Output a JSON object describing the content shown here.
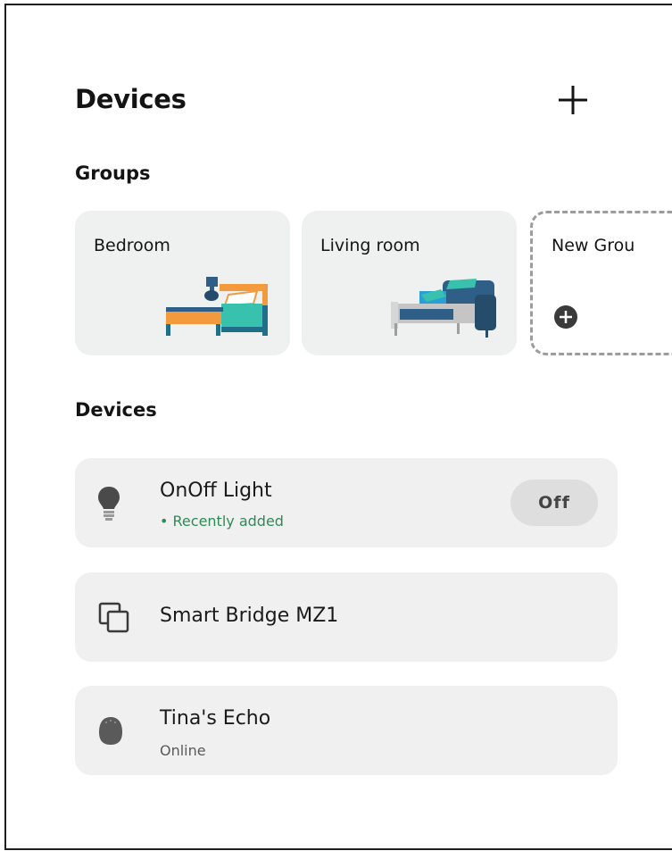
{
  "header": {
    "title": "Devices",
    "add_icon": "plus-icon"
  },
  "groups": {
    "title": "Groups",
    "items": [
      {
        "label": "Bedroom",
        "illustration": "bedroom-illustration"
      },
      {
        "label": "Living room",
        "illustration": "living-room-illustration"
      }
    ],
    "new_group": {
      "label": "New Grou",
      "icon": "plus-circle-icon"
    }
  },
  "devices": {
    "title": "Devices",
    "items": [
      {
        "name": "OnOff Light",
        "status": "• Recently added",
        "icon": "lightbulb-icon",
        "toggle_label": "Off",
        "status_color": "#2e8b57"
      },
      {
        "name": "Smart Bridge MZ1",
        "icon": "bridge-icon"
      },
      {
        "name": "Tina's Echo",
        "status": "Online",
        "icon": "echo-speaker-icon"
      }
    ]
  },
  "colors": {
    "card_bg": "#eff0f0",
    "row_bg": "#f0f0f0",
    "status_green": "#2e8b57",
    "toggle_bg": "#dedede",
    "dashed_border": "#9c9c9c"
  }
}
